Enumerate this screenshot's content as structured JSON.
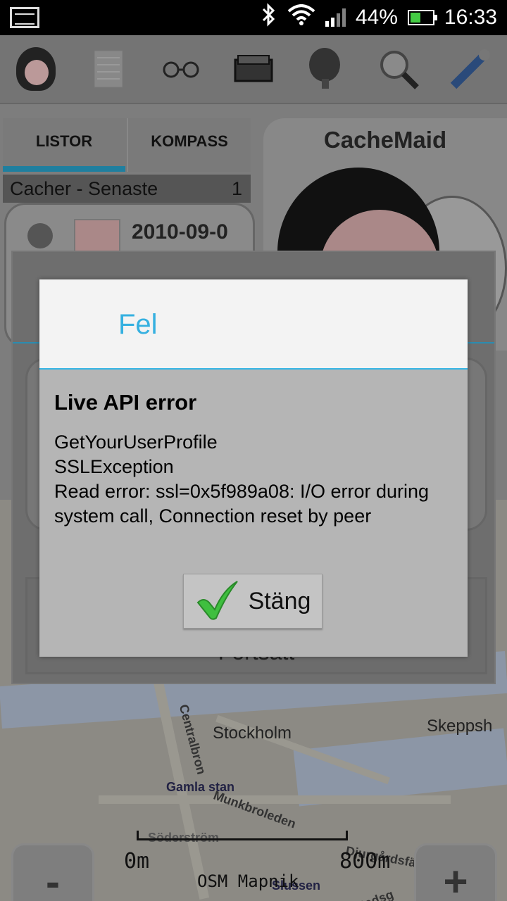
{
  "status_bar": {
    "battery": "44%",
    "time": "16:33",
    "icons": [
      "screenshot-icon",
      "bluetooth-icon",
      "wifi-icon",
      "signal-icon",
      "battery-icon"
    ]
  },
  "toolbar": {
    "icons": [
      "cachemaid-avatar-icon",
      "list-icon",
      "glasses-icon",
      "cache-box-icon",
      "satellite-dish-icon",
      "search-icon",
      "tools-icon"
    ]
  },
  "tabs": [
    {
      "label": "LISTOR",
      "selected": true
    },
    {
      "label": "KOMPASS",
      "selected": false
    }
  ],
  "list": {
    "header_label": "Cacher - Senaste",
    "header_count": "1",
    "first_item_date": "2010-09-0"
  },
  "cachemaid_panel": {
    "title": "CacheMaid"
  },
  "background_panel": {
    "button_label": "Fortsätt"
  },
  "map": {
    "labels": {
      "stockholm": "Stockholm",
      "gamla_stan": "Gamla stan",
      "munkbroleden": "Munkbroleden",
      "soderstrom": "Söderström",
      "slussen": "Slussen",
      "djurgardsfarjan": "Djurgårdsfärjan",
      "skeppsholmen": "Skeppsh",
      "centralbron": "Centralbron",
      "stadsgardsleden": "Stadsg"
    },
    "scale_start": "0m",
    "scale_end": "800m",
    "source": "OSM Mapnik",
    "zoom_out_label": "-",
    "zoom_in_label": "+"
  },
  "dialog": {
    "title": "Fel",
    "heading": "Live API error",
    "message": "GetYourUserProfile\nSSLException\nRead error: ssl=0x5f989a08: I/O error during system call, Connection reset by peer",
    "button_label": "Stäng",
    "button_icon": "checkmark-icon"
  },
  "colors": {
    "accent": "#35b5e5",
    "check_green": "#3fbf3f"
  }
}
